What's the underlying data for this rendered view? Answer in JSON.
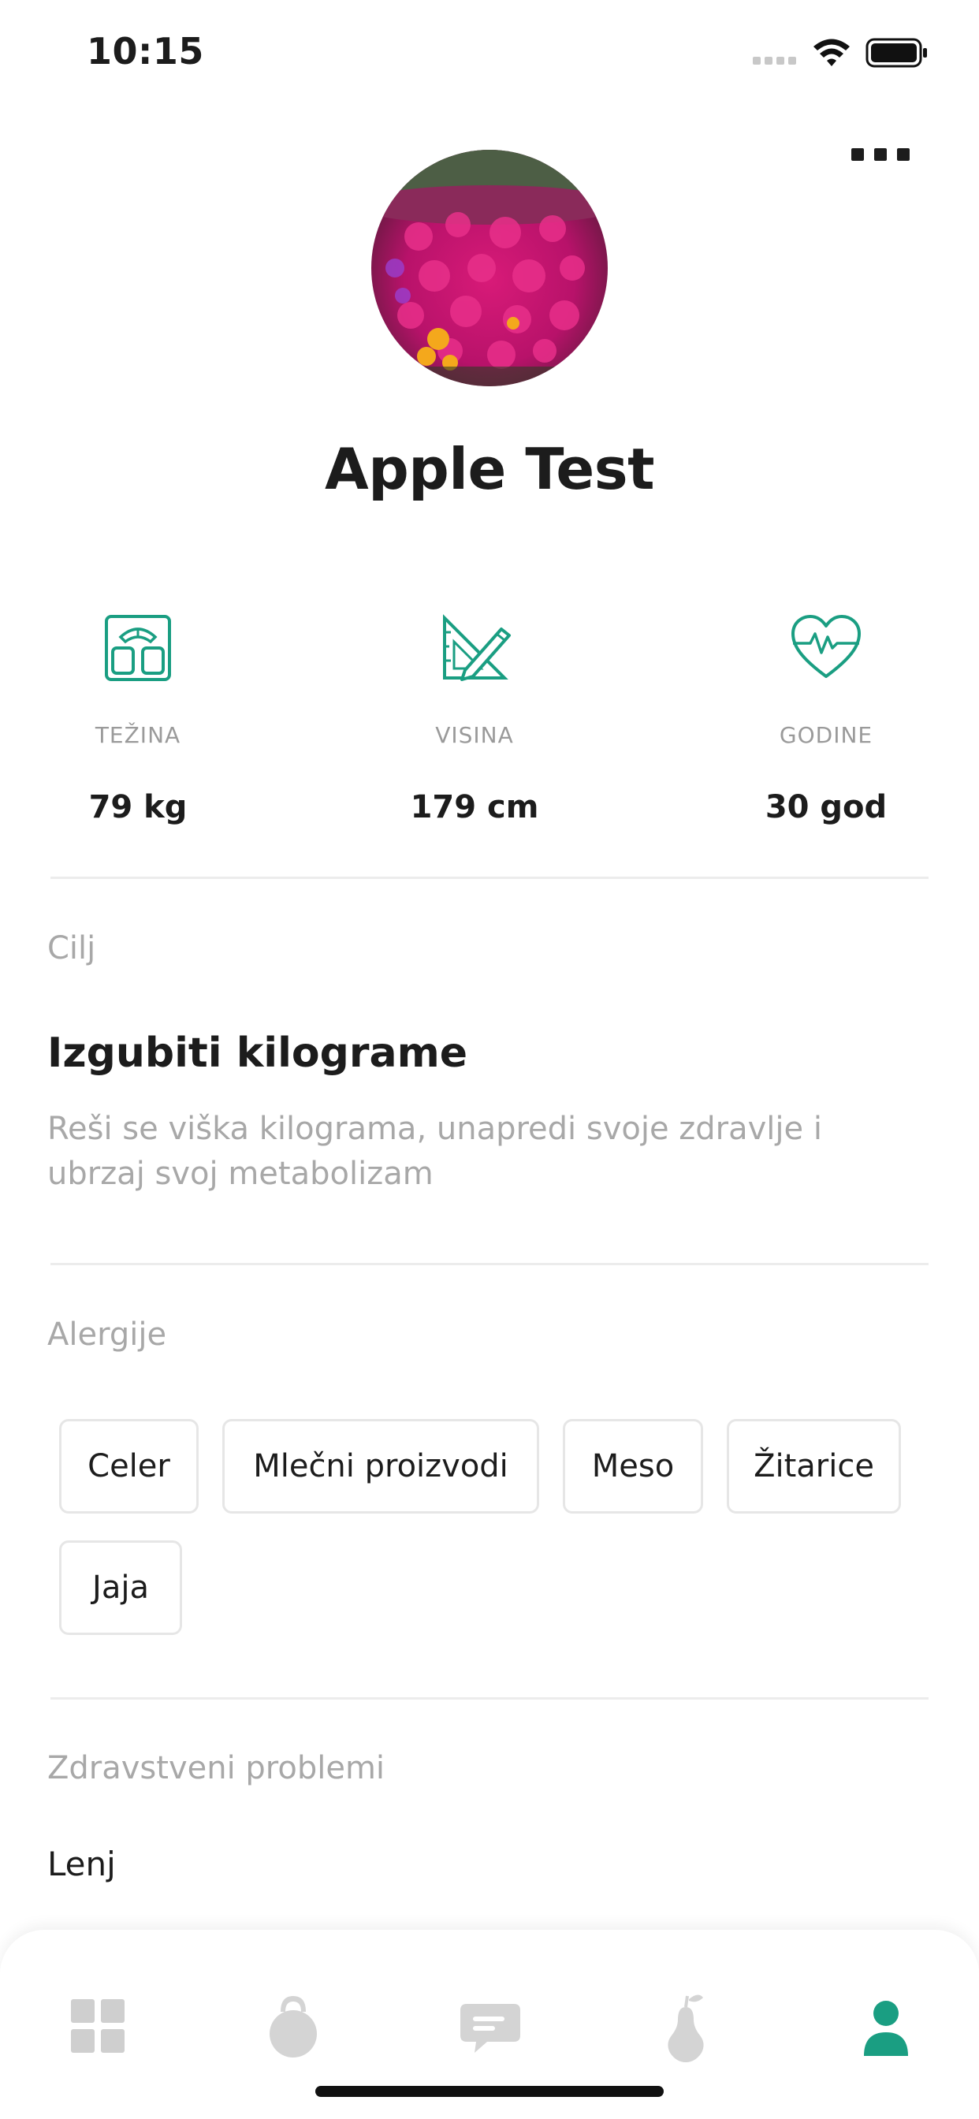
{
  "status_bar": {
    "time": "10:15"
  },
  "profile": {
    "name": "Apple Test"
  },
  "stats": [
    {
      "label": "TEŽINA",
      "value": "79 kg",
      "icon": "scale-icon"
    },
    {
      "label": "VISINA",
      "value": "179 cm",
      "icon": "ruler-pencil-icon"
    },
    {
      "label": "GODINE",
      "value": "30 god",
      "icon": "heart-pulse-icon"
    }
  ],
  "goal": {
    "section_title": "Cilj",
    "title": "Izgubiti kilograme",
    "description": "Reši se viška kilograma, unapredi svoje zdravlje i ubrzaj svoj metabolizam"
  },
  "allergies": {
    "section_title": "Alergije",
    "items": [
      "Celer",
      "Mlečni proizvodi",
      "Meso",
      "Žitarice",
      "Jaja"
    ]
  },
  "health": {
    "section_title": "Zdravstveni problemi",
    "value": "Lenj"
  },
  "tabs": [
    {
      "name": "dashboard",
      "icon": "grid-icon",
      "active": false
    },
    {
      "name": "workouts",
      "icon": "kettlebell-icon",
      "active": false
    },
    {
      "name": "chat",
      "icon": "chat-bubble-icon",
      "active": false
    },
    {
      "name": "nutrition",
      "icon": "pear-icon",
      "active": false
    },
    {
      "name": "profile",
      "icon": "user-icon",
      "active": true
    }
  ],
  "colors": {
    "accent": "#1a9e82",
    "inactive_tab": "#cfcfcf",
    "muted_text": "#a8a8a8"
  }
}
